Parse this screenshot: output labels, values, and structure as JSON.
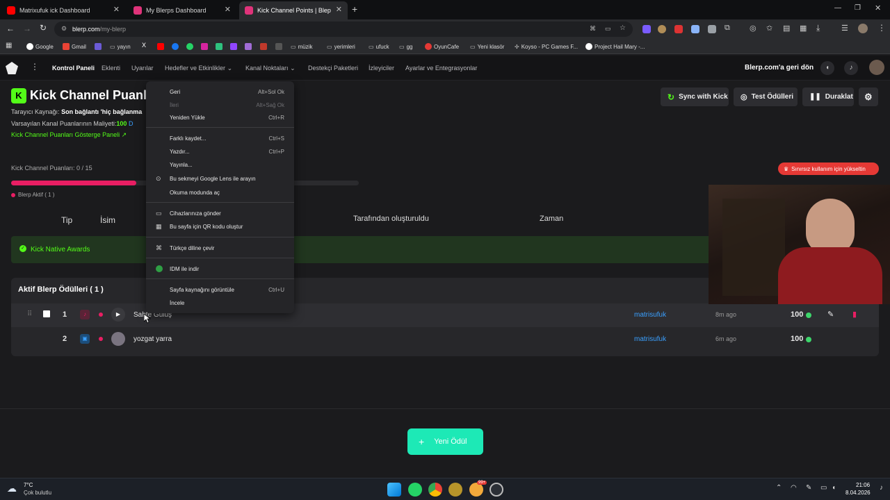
{
  "browser": {
    "tabs": [
      {
        "title": "Matrixufuk ick Dashboard",
        "icon": "youtube-icon"
      },
      {
        "title": "My Blerps Dashboard",
        "icon": "blerp-icon"
      },
      {
        "title": "Kick Channel Points | Blep",
        "icon": "blerp-icon"
      }
    ],
    "url": "blerp.com/my-blerp",
    "url_host": "blerp.com",
    "url_path": "/my-blerp",
    "bookmarks": [
      "Google",
      "Gmail",
      "yayın",
      "müzik",
      "yerimleri",
      "ufuck",
      "gg",
      "OyunCafe",
      "Yeni klasör",
      "Koyso - PC Games F...",
      "Project Hail Mary -..."
    ]
  },
  "appnav": {
    "items": [
      "Kontrol Paneli",
      "Eklenti",
      "Uyarılar",
      "Hedefler ve Etkinlikler",
      "Kanal Noktaları",
      "Destekçi Paketleri",
      "İzleyiciler",
      "Ayarlar ve Entegrasyonlar"
    ],
    "back_link": "Blerp.com'a geri dön"
  },
  "page": {
    "badge_letter": "K",
    "title": "Kick Channel Puanları",
    "source_label": "Tarayıcı Kaynağı:",
    "source_value": "Son bağlantı 'hiç bağlanma",
    "cost_label": "Varsayılan Kanal Puanlarının Maliyeti:",
    "cost_value": "100",
    "cost_edit": "D",
    "dashboard_link": "Kick Channel Puanları Gösterge Paneli",
    "buttons": {
      "sync": "Sync with Kick",
      "test": "Test Ödülleri",
      "pause": "Duraklat"
    },
    "points_label": "Kick Channel Puanları: 0 / 15",
    "progress": 0.36,
    "active_legend": "Blerp Aktif ( 1 )",
    "upgrade": "Sınırsız kullanım için yükseltin",
    "table_headers": {
      "type": "Tip",
      "name": "İsim",
      "created_by": "Tarafından oluşturuldu",
      "time": "Zaman"
    },
    "native_awards": "Kick Native Awards",
    "active_section": "Aktif Blerp Ödülleri ( 1 )",
    "rows": [
      {
        "index": "1",
        "name": "Sahte Gülüş",
        "user": "matrisufuk",
        "time": "8m ago",
        "cost": "100"
      },
      {
        "index": "2",
        "name": "yozgat yarra",
        "user": "matrisufuk",
        "time": "6m ago",
        "cost": "100"
      }
    ],
    "new_reward": "Yeni Ödül"
  },
  "context_menu": {
    "items": [
      {
        "label": "Geri",
        "shortcut": "Alt+Sol Ok"
      },
      {
        "label": "İleri",
        "shortcut": "Alt+Sağ Ok"
      },
      {
        "label": "Yeniden Yükle",
        "shortcut": "Ctrl+R"
      },
      {
        "label": "Farklı kaydet...",
        "shortcut": "Ctrl+S"
      },
      {
        "label": "Yazdır...",
        "shortcut": "Ctrl+P"
      },
      {
        "label": "Yayınla..."
      },
      {
        "label": "Bu sekmeyi Google Lens ile arayın"
      },
      {
        "label": "Okuma modunda aç"
      },
      {
        "label": "Cihazlarınıza gönder"
      },
      {
        "label": "Bu sayfa için QR kodu oluştur"
      },
      {
        "label": "Türkçe diline çevir"
      },
      {
        "label": "IDM ile indir"
      },
      {
        "label": "Sayfa kaynağını görüntüle",
        "shortcut": "Ctrl+U"
      },
      {
        "label": "İncele"
      }
    ]
  },
  "taskbar": {
    "temperature": "7°C",
    "weather": "Çok bulutlu",
    "time": "21:06",
    "date": "8.04.2026",
    "badge": "99+"
  },
  "colors": {
    "accent": "#1de9b6",
    "pink": "#e91e63",
    "green": "#3dd66b",
    "link": "#3aa0ff",
    "kick": "#53fc18"
  }
}
